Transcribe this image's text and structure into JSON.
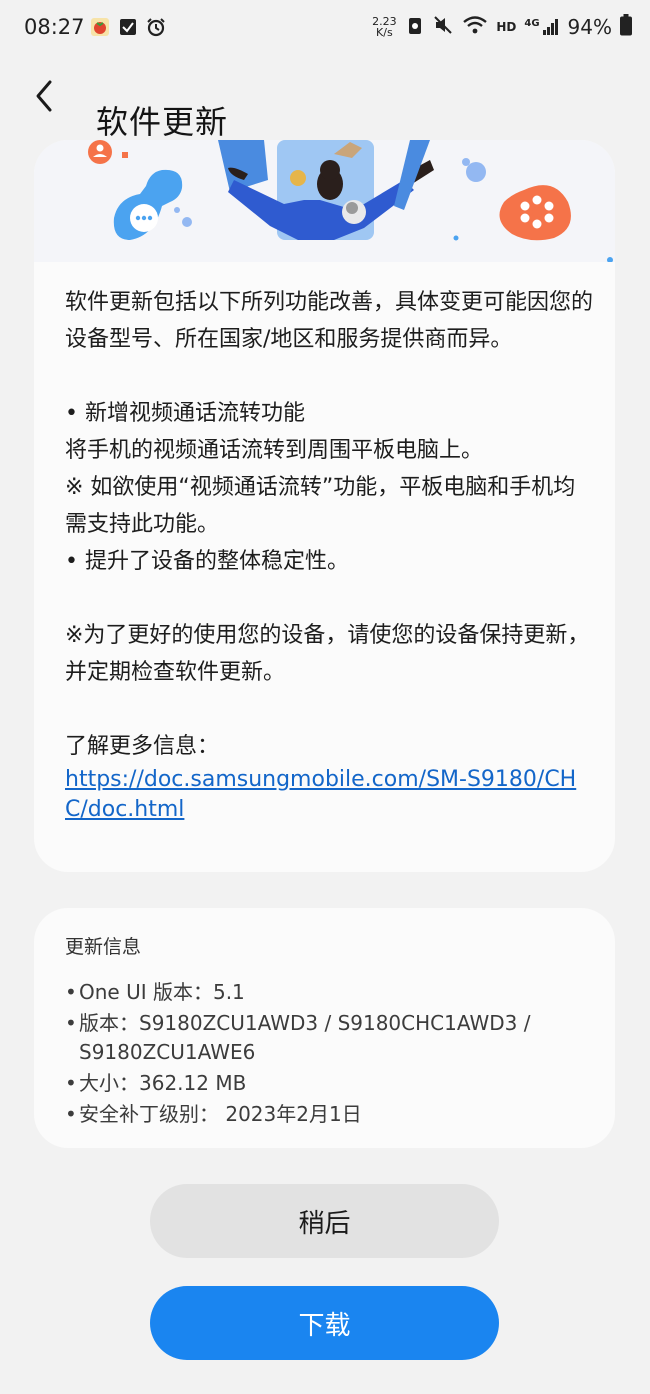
{
  "status_bar": {
    "time": "08:27",
    "net_speed_value": "2.23",
    "net_speed_unit": "K/s",
    "hd_label": "HD",
    "network_label": "4G",
    "battery": "94%"
  },
  "header": {
    "title": "软件更新"
  },
  "notes": {
    "intro": "软件更新包括以下所列功能改善，具体变更可能因您的设备型号、所在国家/地区和服务提供商而异。",
    "feature_title": "• 新增视频通话流转功能",
    "feature_desc": "将手机的视频通话流转到周围平板电脑上。",
    "feature_note": "※ 如欲使用“视频通话流转”功能，平板电脑和手机均需支持此功能。",
    "stability": "• 提升了设备的整体稳定性。",
    "advice": "※为了更好的使用您的设备，请使您的设备保持更新，并定期检查软件更新。",
    "more_info_label": "了解更多信息：",
    "more_info_link": "https://doc.samsungmobile.com/SM-S9180/CHC/doc.html"
  },
  "update_info": {
    "title": "更新信息",
    "items": [
      "One UI 版本：5.1",
      "版本：S9180ZCU1AWD3 / S9180CHC1AWD3 / S9180ZCU1AWE6",
      "大小：362.12 MB",
      "安全补丁级别： 2023年2月1日"
    ]
  },
  "buttons": {
    "later": "稍后",
    "download": "下载"
  },
  "colors": {
    "accent": "#1a85f0",
    "link": "#1366c9",
    "background": "#f2f2f2",
    "card": "#fbfbfb"
  }
}
